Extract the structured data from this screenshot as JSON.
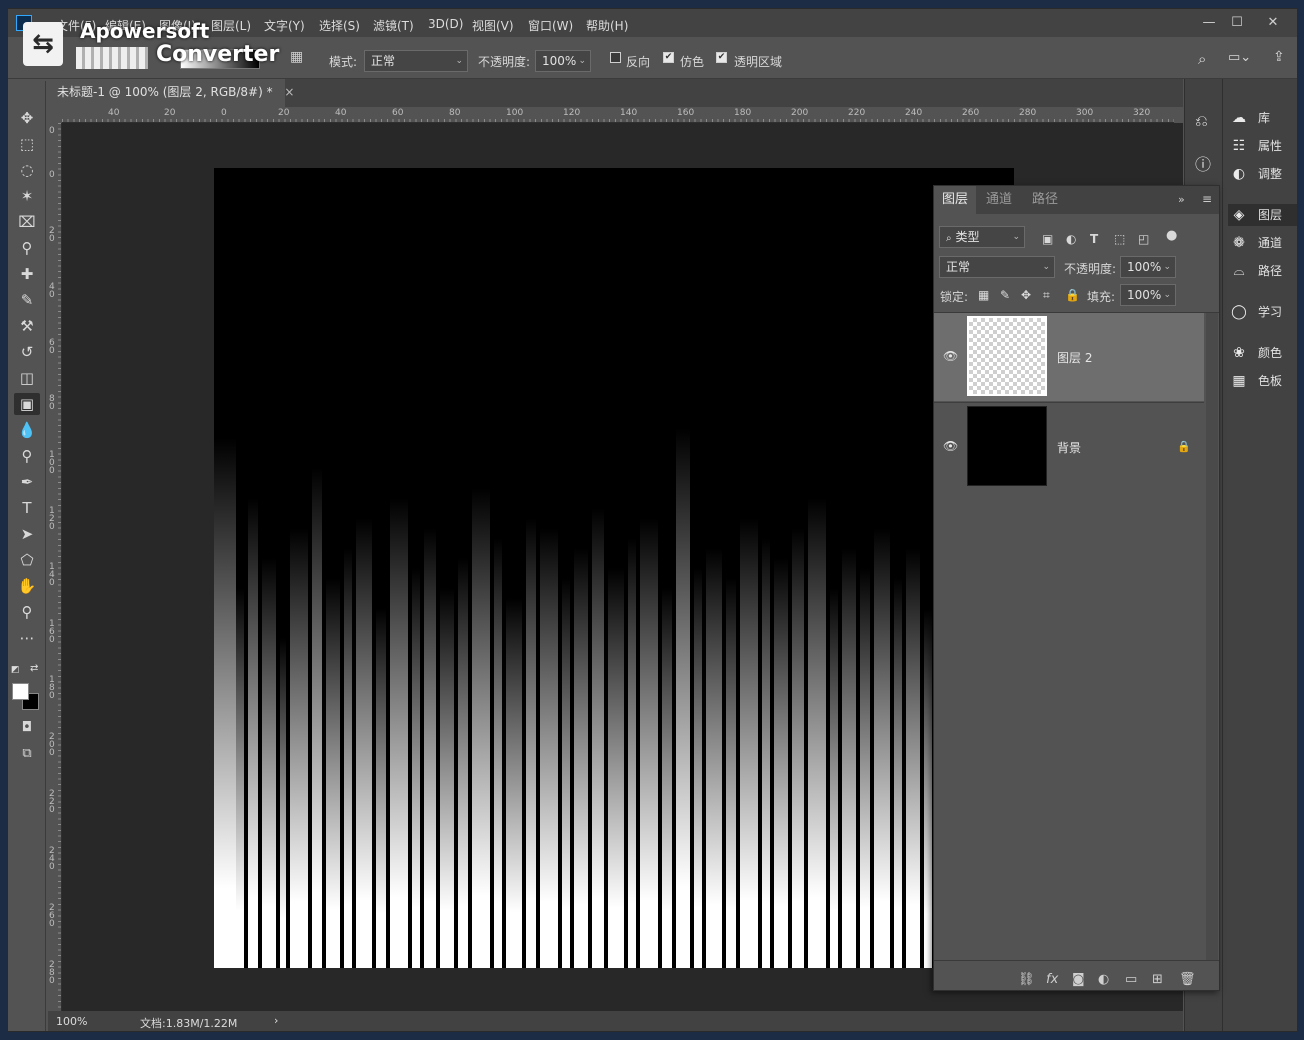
{
  "menubar": {
    "items": [
      "文件(F)",
      "编辑(E)",
      "图像(I)",
      "图层(L)",
      "文字(Y)",
      "选择(S)",
      "滤镜(T)",
      "3D(D)",
      "视图(V)",
      "窗口(W)",
      "帮助(H)"
    ]
  },
  "window_controls": {
    "minimize": "—",
    "maximize": "☐",
    "close": "✕"
  },
  "watermark": {
    "line1": "Apowersoft",
    "line2": "Converter"
  },
  "options": {
    "mode_label": "模式:",
    "mode_value": "正常",
    "opacity_label": "不透明度:",
    "opacity_value": "100%",
    "reverse_label": "反向",
    "reverse_checked": false,
    "dither_label": "仿色",
    "dither_checked": true,
    "transparency_label": "透明区域",
    "transparency_checked": true
  },
  "document": {
    "tab_title": "未标题-1 @ 100% (图层 2, RGB/8#) *",
    "close": "×"
  },
  "hruler_labels": [
    "40",
    "20",
    "0",
    "20",
    "40",
    "60",
    "80",
    "100",
    "120",
    "140",
    "160",
    "180",
    "200",
    "220",
    "240",
    "260",
    "280",
    "300",
    "320"
  ],
  "vruler_labels": [
    "0",
    "0",
    "2 0",
    "4 0",
    "6 0",
    "8 0",
    "1 0 0",
    "1 2 0",
    "1 4 0",
    "1 6 0",
    "1 8 0",
    "2 0 0",
    "2 2 0",
    "2 4 0",
    "2 6 0",
    "2 8 0"
  ],
  "status": {
    "zoom": "100%",
    "doc": "文档:1.83M/1.22M",
    "arrow": "›"
  },
  "dock": {
    "items": [
      {
        "icon": "libraries-icon",
        "label": "库"
      },
      {
        "icon": "properties-icon",
        "label": "属性"
      },
      {
        "icon": "adjustments-icon",
        "label": "调整"
      },
      {
        "icon": "layers-icon",
        "label": "图层"
      },
      {
        "icon": "channels-icon",
        "label": "通道"
      },
      {
        "icon": "paths-icon",
        "label": "路径"
      },
      {
        "icon": "learn-icon",
        "label": "学习"
      },
      {
        "icon": "color-icon",
        "label": "颜色"
      },
      {
        "icon": "swatches-icon",
        "label": "色板"
      }
    ]
  },
  "layers_panel": {
    "tabs": [
      "图层",
      "通道",
      "路径"
    ],
    "active_tab": "图层",
    "filter_label": "类型",
    "blend_mode": "正常",
    "opacity_label": "不透明度:",
    "opacity_value": "100%",
    "lock_label": "锁定:",
    "fill_label": "填充:",
    "fill_value": "100%",
    "layers": [
      {
        "name": "图层 2",
        "selected": true,
        "thumb": "transparent",
        "locked": false
      },
      {
        "name": "背景",
        "selected": false,
        "thumb": "black",
        "locked": true
      }
    ]
  },
  "colors": {
    "ui_bg": "#535353",
    "panel_dark": "#424242",
    "workspace": "#282828",
    "selected_layer": "#6e6e6e",
    "foreground": "#ffffff",
    "background": "#000000"
  }
}
